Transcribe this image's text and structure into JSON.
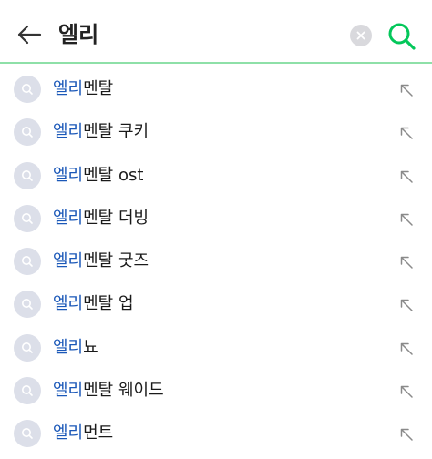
{
  "search": {
    "query": "엘리",
    "back_icon": "back-arrow-icon",
    "clear_icon": "clear-icon",
    "submit_icon": "search-icon",
    "accent_color": "#03c75a"
  },
  "suggestions": [
    {
      "match": "엘리",
      "rest": "멘탈"
    },
    {
      "match": "엘리",
      "rest": "멘탈 쿠키"
    },
    {
      "match": "엘리",
      "rest": "멘탈 ost"
    },
    {
      "match": "엘리",
      "rest": "멘탈 더빙"
    },
    {
      "match": "엘리",
      "rest": "멘탈 굿즈"
    },
    {
      "match": "엘리",
      "rest": "멘탈 업"
    },
    {
      "match": "엘리",
      "rest": "뇨"
    },
    {
      "match": "엘리",
      "rest": "멘탈 웨이드"
    },
    {
      "match": "엘리",
      "rest": "먼트"
    }
  ]
}
